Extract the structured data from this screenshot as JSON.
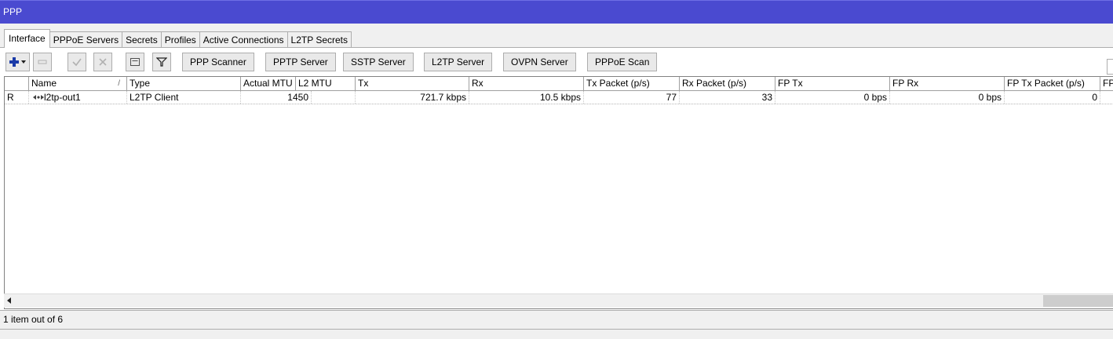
{
  "window": {
    "title": "PPP"
  },
  "tabs": [
    {
      "label": "Interface",
      "active": true
    },
    {
      "label": "PPPoE Servers"
    },
    {
      "label": "Secrets"
    },
    {
      "label": "Profiles"
    },
    {
      "label": "Active Connections"
    },
    {
      "label": "L2TP Secrets"
    }
  ],
  "toolbar": {
    "icons": [
      "plus-dropdown-icon",
      "minus-icon",
      "check-icon",
      "cross-icon",
      "comment-icon",
      "filter-icon"
    ],
    "buttons": [
      "PPP Scanner",
      "PPTP Server",
      "SSTP Server",
      "L2TP Server",
      "OVPN Server",
      "PPPoE Scan"
    ]
  },
  "table": {
    "columns": [
      "",
      "Name",
      "Type",
      "Actual MTU",
      "L2 MTU",
      "Tx",
      "Rx",
      "Tx Packet (p/s)",
      "Rx Packet (p/s)",
      "FP Tx",
      "FP Rx",
      "FP Tx Packet (p/s)",
      "FP"
    ],
    "sort_marker": "/",
    "rows": [
      {
        "flag": "R",
        "name": "l2tp-out1",
        "type": "L2TP Client",
        "actual_mtu": "1450",
        "l2_mtu": "",
        "tx": "721.7 kbps",
        "rx": "10.5 kbps",
        "tx_packet": "77",
        "rx_packet": "33",
        "fp_tx": "0 bps",
        "fp_rx": "0 bps",
        "fp_tx_packet": "0"
      }
    ]
  },
  "status": {
    "text": "1 item out of 6"
  },
  "colors": {
    "titlebar": "#4a4ad0",
    "plus_icon": "#1a3aa8"
  }
}
